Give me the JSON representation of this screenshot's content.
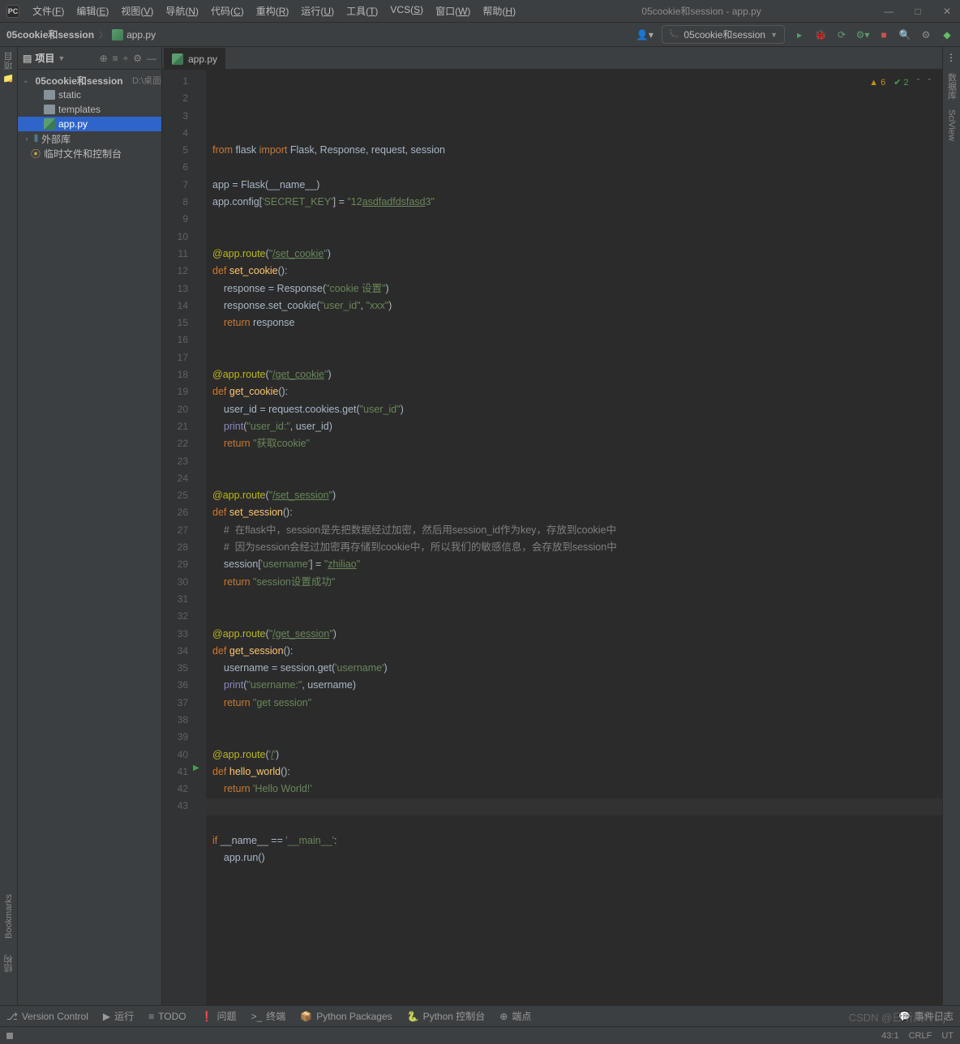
{
  "window": {
    "title": "05cookie和session - app.py",
    "min": "—",
    "max": "□",
    "close": "✕"
  },
  "menu": [
    {
      "label": "文件",
      "u": "F"
    },
    {
      "label": "编辑",
      "u": "E"
    },
    {
      "label": "视图",
      "u": "V"
    },
    {
      "label": "导航",
      "u": "N"
    },
    {
      "label": "代码",
      "u": "C"
    },
    {
      "label": "重构",
      "u": "R"
    },
    {
      "label": "运行",
      "u": "U"
    },
    {
      "label": "工具",
      "u": "T"
    },
    {
      "label": "VCS",
      "u": "S"
    },
    {
      "label": "窗口",
      "u": "W"
    },
    {
      "label": "帮助",
      "u": "H"
    }
  ],
  "breadcrumb": {
    "project": "05cookie和session",
    "file": "app.py"
  },
  "run_config": "05cookie和session",
  "sidebar": {
    "title": "项目",
    "project_name": "05cookie和session",
    "project_path": "D:\\桌面\\fla",
    "folders": [
      "static",
      "templates"
    ],
    "file": "app.py",
    "ext_lib": "外部库",
    "scratch": "临时文件和控制台"
  },
  "left_tabs": {
    "project": "项目",
    "structure": "结构",
    "bookmarks": "Bookmarks"
  },
  "right_tabs": {
    "db": "数据库",
    "sciview": "SciView"
  },
  "editor_tab": "app.py",
  "inspections": {
    "warn": "6",
    "ok": "2"
  },
  "code_lines": [
    "<span class='kw'>from</span> flask <span class='kw'>import</span> Flask, Response, request, session",
    "",
    "app = Flask(__name__)",
    "app.config[<span class='str'>'SECRET_KEY'</span>] = <span class='str'>\"12</span><span class='lnk'>asdfadfdsfasd</span><span class='str'>3\"</span>",
    "",
    "",
    "<span class='dec'>@app.route</span>(<span class='str'>\"</span><span class='lnk'>/set_cookie</span><span class='str'>\"</span>)",
    "<span class='kw'>def</span> <span class='fn'>set_cookie</span>():",
    "    response = Response(<span class='str'>\"cookie 设置\"</span>)",
    "    response.set_cookie(<span class='str'>\"user_id\"</span>, <span class='str'>\"xxx\"</span>)",
    "    <span class='kw'>return</span> response",
    "",
    "",
    "<span class='dec'>@app.route</span>(<span class='str'>\"</span><span class='lnk'>/get_cookie</span><span class='str'>\"</span>)",
    "<span class='kw'>def</span> <span class='fn'>get_cookie</span>():",
    "    user_id = request.cookies.get(<span class='str'>\"user_id\"</span>)",
    "    <span class='bi'>print</span>(<span class='str'>\"user_id:\"</span>, user_id)",
    "    <span class='kw'>return</span> <span class='str'>\"获取cookie\"</span>",
    "",
    "",
    "<span class='dec'>@app.route</span>(<span class='str'>\"</span><span class='lnk'>/set_session</span><span class='str'>\"</span>)",
    "<span class='kw'>def</span> <span class='fn'>set_session</span>():",
    "    <span class='cmt'>#  在flask中，session是先把数据经过加密，然后用session_id作为key，存放到cookie中</span>",
    "    <span class='cmt'>#  因为session会经过加密再存储到cookie中，所以我们的敏感信息，会存放到session中</span>",
    "    session[<span class='str'>'username'</span>] = <span class='str'>\"</span><span class='lnk'>zhiliao</span><span class='str'>\"</span>",
    "    <span class='kw'>return</span> <span class='str'>\"session设置成功\"</span>",
    "",
    "",
    "<span class='dec'>@app.route</span>(<span class='str'>\"</span><span class='lnk'>/get_session</span><span class='str'>\"</span>)",
    "<span class='kw'>def</span> <span class='fn'>get_session</span>():",
    "    username = session.get(<span class='str'>'username'</span>)",
    "    <span class='bi'>print</span>(<span class='str'>\"username:\"</span>, username)",
    "    <span class='kw'>return</span> <span class='str'>\"get session\"</span>",
    "",
    "",
    "<span class='dec'>@app.route</span>(<span class='str'>'</span><span class='lnk'>/</span><span class='str'>'</span>)",
    "<span class='kw'>def</span> <span class='fn'>hello_world</span>():",
    "    <span class='kw'>return</span> <span class='str'>'Hello World!'</span>",
    "",
    "",
    "<span class='kw'>if</span> __name__ == <span class='str'>'__main__'</span>:",
    "    app.run()",
    ""
  ],
  "bottom": [
    {
      "ico": "⎇",
      "label": "Version Control"
    },
    {
      "ico": "▶",
      "label": "运行"
    },
    {
      "ico": "≡",
      "label": "TODO"
    },
    {
      "ico": "❗",
      "label": "问题"
    },
    {
      "ico": ">_",
      "label": "终端"
    },
    {
      "ico": "📦",
      "label": "Python Packages"
    },
    {
      "ico": "🐍",
      "label": "Python 控制台"
    },
    {
      "ico": "⊕",
      "label": "端点"
    }
  ],
  "bottom_right": {
    "ico": "💬",
    "label": "事件日志"
  },
  "status": {
    "pos": "43:1",
    "crlf": "CRLF",
    "enc": "UT",
    "more": "…"
  },
  "watermark": "CSDN @日听风吟tnj"
}
